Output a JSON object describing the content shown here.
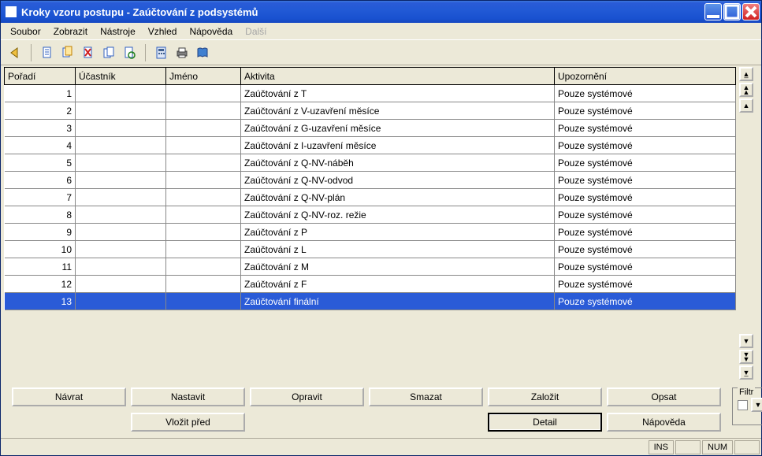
{
  "window": {
    "title": "Kroky vzoru postupu - Zaúčtování z podsystémů"
  },
  "menu": {
    "items": [
      {
        "label": "Soubor",
        "disabled": false
      },
      {
        "label": "Zobrazit",
        "disabled": false
      },
      {
        "label": "Nástroje",
        "disabled": false
      },
      {
        "label": "Vzhled",
        "disabled": false
      },
      {
        "label": "Nápověda",
        "disabled": false
      },
      {
        "label": "Další",
        "disabled": true
      }
    ]
  },
  "grid": {
    "columns": [
      {
        "label": "Pořadí",
        "width": "90"
      },
      {
        "label": "Účastník",
        "width": "115"
      },
      {
        "label": "Jméno",
        "width": "95"
      },
      {
        "label": "Aktivita",
        "width": "375"
      },
      {
        "label": "Upozornění",
        "width": "230"
      }
    ],
    "rows": [
      {
        "poradi": "1",
        "ucastnik": "",
        "jmeno": "",
        "aktivita": "Zaúčtování z T",
        "upozorneni": "Pouze systémové",
        "selected": false
      },
      {
        "poradi": "2",
        "ucastnik": "",
        "jmeno": "",
        "aktivita": "Zaúčtování z V-uzavření měsíce",
        "upozorneni": "Pouze systémové",
        "selected": false
      },
      {
        "poradi": "3",
        "ucastnik": "",
        "jmeno": "",
        "aktivita": "Zaúčtování z G-uzavření měsíce",
        "upozorneni": "Pouze systémové",
        "selected": false
      },
      {
        "poradi": "4",
        "ucastnik": "",
        "jmeno": "",
        "aktivita": "Zaúčtování z I-uzavření měsíce",
        "upozorneni": "Pouze systémové",
        "selected": false
      },
      {
        "poradi": "5",
        "ucastnik": "",
        "jmeno": "",
        "aktivita": "Zaúčtování z Q-NV-náběh",
        "upozorneni": "Pouze systémové",
        "selected": false
      },
      {
        "poradi": "6",
        "ucastnik": "",
        "jmeno": "",
        "aktivita": "Zaúčtování z Q-NV-odvod",
        "upozorneni": "Pouze systémové",
        "selected": false
      },
      {
        "poradi": "7",
        "ucastnik": "",
        "jmeno": "",
        "aktivita": "Zaúčtování z Q-NV-plán",
        "upozorneni": "Pouze systémové",
        "selected": false
      },
      {
        "poradi": "8",
        "ucastnik": "",
        "jmeno": "",
        "aktivita": "Zaúčtování z Q-NV-roz. režie",
        "upozorneni": "Pouze systémové",
        "selected": false
      },
      {
        "poradi": "9",
        "ucastnik": "",
        "jmeno": "",
        "aktivita": "Zaúčtování z P",
        "upozorneni": "Pouze systémové",
        "selected": false
      },
      {
        "poradi": "10",
        "ucastnik": "",
        "jmeno": "",
        "aktivita": "Zaúčtování z L",
        "upozorneni": "Pouze systémové",
        "selected": false
      },
      {
        "poradi": "11",
        "ucastnik": "",
        "jmeno": "",
        "aktivita": "Zaúčtování z M",
        "upozorneni": "Pouze systémové",
        "selected": false
      },
      {
        "poradi": "12",
        "ucastnik": "",
        "jmeno": "",
        "aktivita": "Zaúčtování z  F",
        "upozorneni": "Pouze systémové",
        "selected": false
      },
      {
        "poradi": "13",
        "ucastnik": "",
        "jmeno": "",
        "aktivita": "Zaúčtování finální",
        "upozorneni": "Pouze systémové",
        "selected": true
      }
    ]
  },
  "buttons": {
    "navrat": "Návrat",
    "nastavit": "Nastavit",
    "opravit": "Opravit",
    "smazat": "Smazat",
    "zalozit": "Založit",
    "opsat": "Opsat",
    "vlozit_pred": "Vložit před",
    "detail": "Detail",
    "napoveda": "Nápověda"
  },
  "filter": {
    "label": "Filtr"
  },
  "status": {
    "ins": "INS",
    "num": "NUM"
  }
}
